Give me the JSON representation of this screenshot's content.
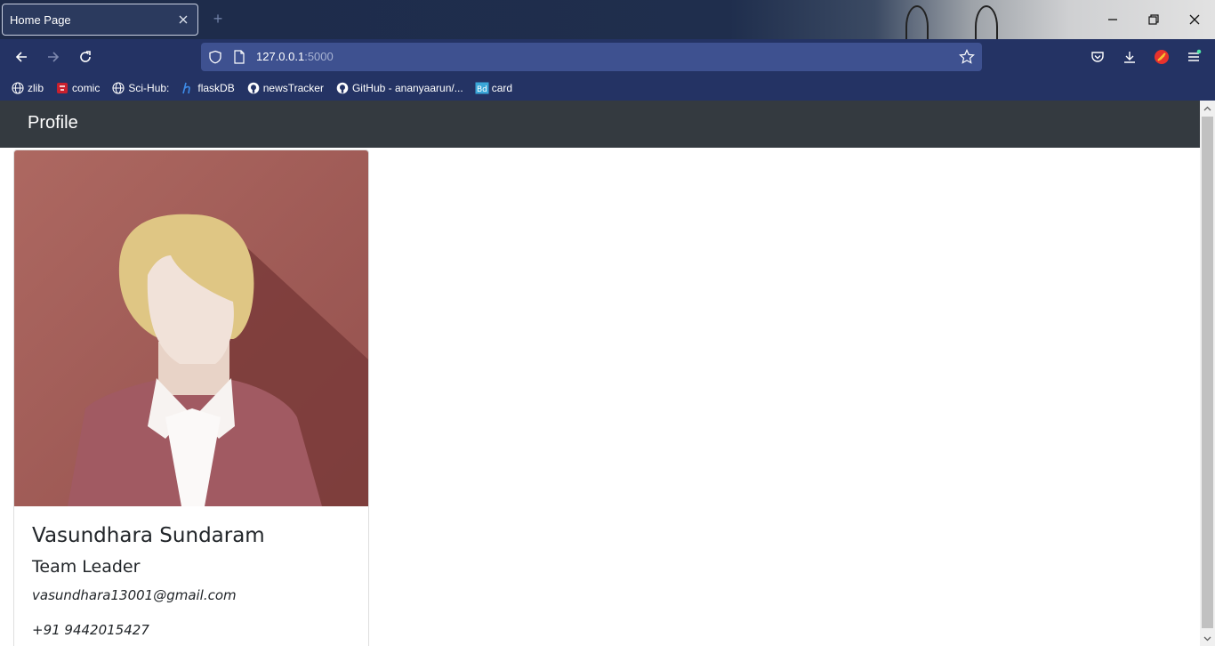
{
  "browser": {
    "tab_title": "Home Page",
    "new_tab_symbol": "+",
    "url_host": "127.0.0.1",
    "url_port": ":5000",
    "bookmarks": [
      {
        "label": "zlib",
        "icon": "globe-icon"
      },
      {
        "label": "comic",
        "icon": "comic-icon"
      },
      {
        "label": "Sci-Hub:",
        "icon": "globe-icon"
      },
      {
        "label": "flaskDB",
        "icon": "h-icon"
      },
      {
        "label": "newsTracker",
        "icon": "github-icon"
      },
      {
        "label": "GitHub - ananyaarun/...",
        "icon": "github-icon"
      },
      {
        "label": "card",
        "icon": "bd-icon"
      }
    ]
  },
  "app": {
    "brand": "Profile"
  },
  "profile": {
    "name": "Vasundhara Sundaram",
    "role": "Team Leader",
    "email": "vasundhara13001@gmail.com",
    "phone": "+91 9442015427"
  },
  "colors": {
    "titlebar": "#1e2b4a",
    "navbar": "#243364",
    "urlbar": "#3e5190",
    "app_nav": "#343a40",
    "avatar_bg": "#a5635f",
    "avatar_shadow": "#7a3b39",
    "hair": "#dfc684",
    "skin": "#f1e2d9",
    "jacket": "#a15a62"
  }
}
